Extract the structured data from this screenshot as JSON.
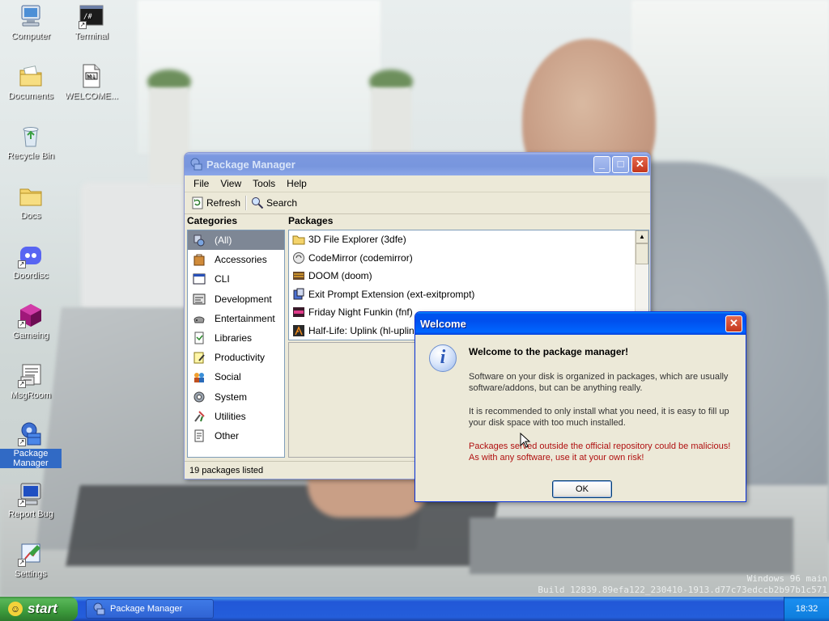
{
  "desktop": {
    "icons": [
      {
        "label": "Computer",
        "icon": "computer-icon"
      },
      {
        "label": "Terminal",
        "icon": "terminal-icon"
      },
      {
        "label": "Documents",
        "icon": "documents-folder-icon"
      },
      {
        "label": "WELCOME...",
        "icon": "markdown-file-icon"
      },
      {
        "label": "Recycle Bin",
        "icon": "recycle-bin-icon"
      },
      {
        "label": "Docs",
        "icon": "folder-icon"
      },
      {
        "label": "Doordisc",
        "icon": "doordisc-icon"
      },
      {
        "label": "Gameing",
        "icon": "gameing-cube-icon"
      },
      {
        "label": "MsgRoom",
        "icon": "msgroom-icon"
      },
      {
        "label": "Package Manager",
        "icon": "package-manager-icon",
        "selected": true
      },
      {
        "label": "Report Bug",
        "icon": "report-bug-icon"
      },
      {
        "label": "Settings",
        "icon": "settings-icon"
      }
    ],
    "watermark": [
      "Windows 96 main",
      "Build 12839.89efa122_230410-1913.d77c73edccb2b97b1c571"
    ]
  },
  "package_manager": {
    "title": "Package Manager",
    "menu": [
      "File",
      "View",
      "Tools",
      "Help"
    ],
    "toolbar": {
      "refresh": "Refresh",
      "search": "Search"
    },
    "categories_header": "Categories",
    "packages_header": "Packages",
    "categories": [
      {
        "label": "(All)",
        "icon": "all-icon",
        "selected": true
      },
      {
        "label": "Accessories",
        "icon": "accessories-icon"
      },
      {
        "label": "CLI",
        "icon": "cli-icon"
      },
      {
        "label": "Development",
        "icon": "development-icon"
      },
      {
        "label": "Entertainment",
        "icon": "entertainment-icon"
      },
      {
        "label": "Libraries",
        "icon": "libraries-icon"
      },
      {
        "label": "Productivity",
        "icon": "productivity-icon"
      },
      {
        "label": "Social",
        "icon": "social-icon"
      },
      {
        "label": "System",
        "icon": "system-icon"
      },
      {
        "label": "Utilities",
        "icon": "utilities-icon"
      },
      {
        "label": "Other",
        "icon": "other-icon"
      }
    ],
    "packages": [
      {
        "label": "3D File Explorer (3dfe)",
        "icon": "folder-icon"
      },
      {
        "label": "CodeMirror (codemirror)",
        "icon": "codemirror-icon"
      },
      {
        "label": "DOOM (doom)",
        "icon": "doom-icon"
      },
      {
        "label": "Exit Prompt Extension (ext-exitprompt)",
        "icon": "extension-icon"
      },
      {
        "label": "Friday Night Funkin (fnf)",
        "icon": "fnf-icon"
      },
      {
        "label": "Half-Life: Uplink (hl-uplink)",
        "icon": "half-life-icon"
      }
    ],
    "status": "19 packages listed"
  },
  "welcome_dialog": {
    "title": "Welcome",
    "heading": "Welcome to the package manager!",
    "para1": "Software on your disk is organized in packages, which are usually software/addons, but can be anything really.",
    "para2": "It is recommended to only install what you need, it is easy to fill up your disk space with too much installed.",
    "warning": "Packages served outside the official repository could be malicious! As with any software, use it at your own risk!",
    "ok": "OK"
  },
  "taskbar": {
    "start": "start",
    "task": "Package Manager",
    "clock": "18:32"
  },
  "colors": {
    "title_active": "#0053ee",
    "selection": "#316ac5",
    "warning_text": "#b01010",
    "start_green": "#3c9a3c"
  }
}
